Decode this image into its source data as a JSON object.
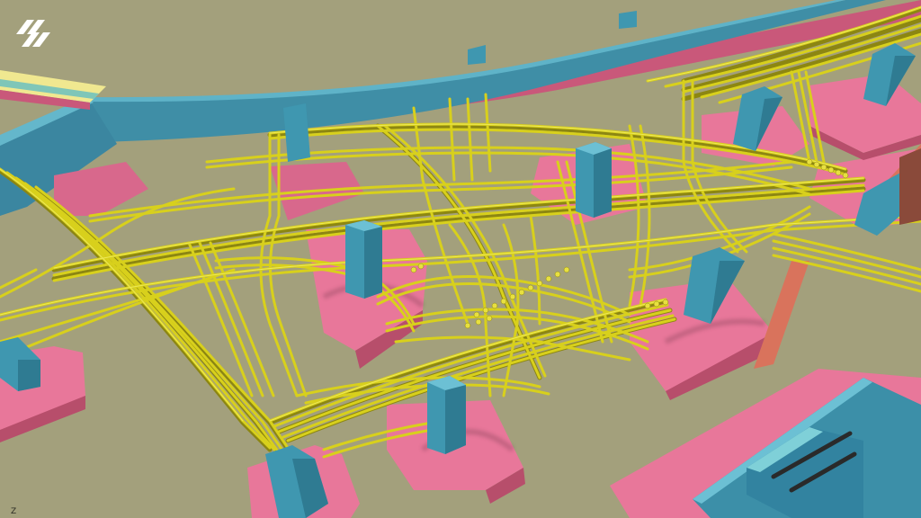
{
  "viewport": {
    "axis_indicator": "Z",
    "background_color": "#a3a07c"
  },
  "branding": {
    "logo_icon": "app-logo-icon"
  },
  "colors": {
    "pipes": "#d8d01c",
    "pipe_highlight": "#f2ee6a",
    "pipe_shadow": "#8c8612",
    "foundation_pads": "#e0708f",
    "columns": "#3f97b0",
    "walls": "#3c8fa8",
    "elevated_path": "#f0e890"
  }
}
